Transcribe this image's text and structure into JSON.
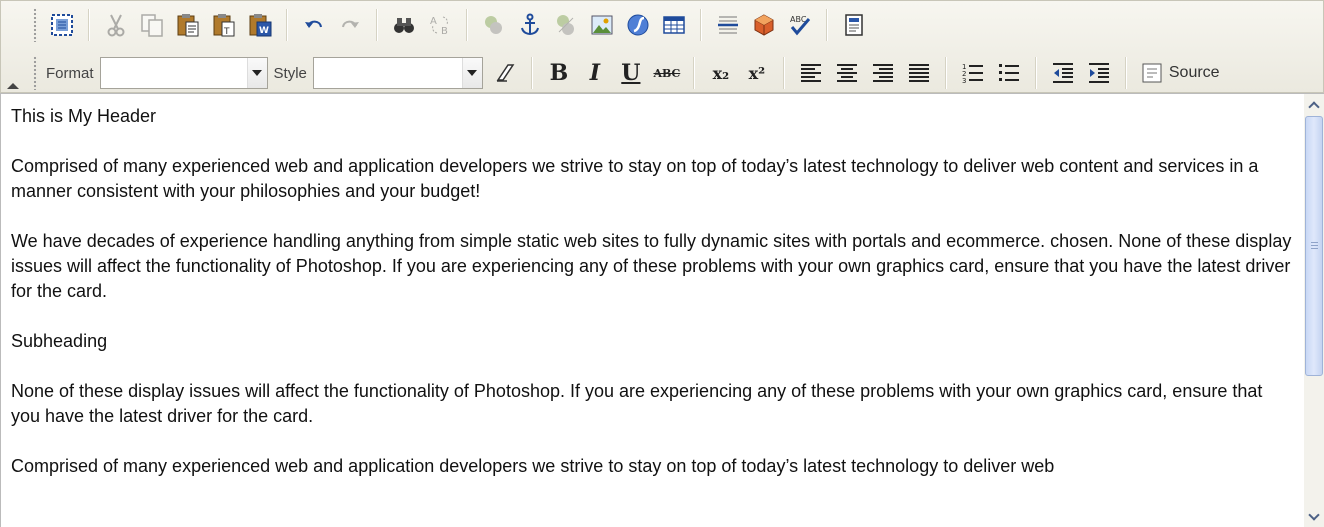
{
  "toolbar": {
    "format_label": "Format",
    "format_value": "",
    "style_label": "Style",
    "style_value": "",
    "source_label": "Source",
    "bold_glyph": "B",
    "italic_glyph": "I",
    "underline_glyph": "U",
    "strike_glyph": "ABC",
    "subscript_glyph": "x₂",
    "superscript_glyph": "x²"
  },
  "icons": [
    "select-all-icon",
    "cut-icon",
    "copy-icon",
    "paste-icon",
    "paste-text-icon",
    "paste-word-icon",
    "undo-icon",
    "redo-icon",
    "find-icon",
    "replace-icon",
    "flash-icon",
    "anchor-icon",
    "link-icon",
    "image-icon",
    "flash-object-icon",
    "table-icon",
    "horizontal-rule-icon",
    "special-char-icon",
    "spellcheck-icon",
    "template-icon",
    "remove-format-icon",
    "align-left-icon",
    "align-center-icon",
    "align-right-icon",
    "justify-icon",
    "numbered-list-icon",
    "bullet-list-icon",
    "outdent-icon",
    "indent-icon",
    "source-icon"
  ],
  "editor": {
    "paragraphs": [
      "This is My Header",
      "Comprised of many experienced web and application developers we strive to stay on top of today’s latest technology to deliver web content and services in a manner consistent with your philosophies and your budget!",
      "We have decades of experience handling anything from simple static web sites to fully dynamic sites with portals and ecommerce. chosen. None of these display issues will affect the functionality of Photoshop. If you are experiencing any of these problems with your own graphics card, ensure that you have the latest driver for the card.",
      "Subheading",
      "None of these display issues will affect the functionality of Photoshop. If you are experiencing any of these problems with your own graphics card, ensure that you have the latest driver for the card.",
      "Comprised of many experienced web and application developers we strive to stay on top of today’s latest technology to deliver web"
    ]
  }
}
